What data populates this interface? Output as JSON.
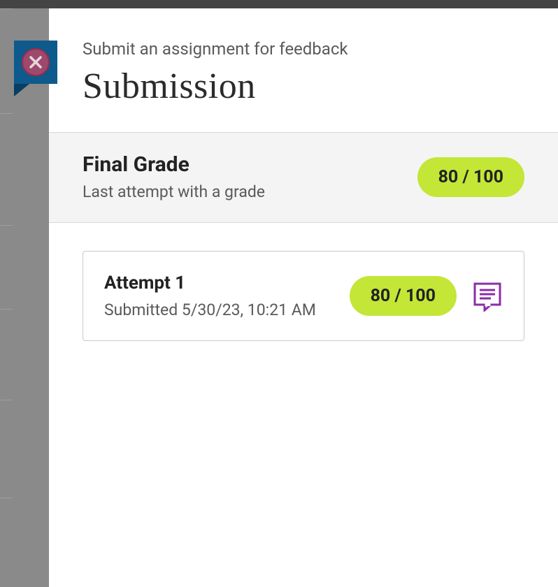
{
  "header": {
    "pretitle": "Submit an assignment for feedback",
    "title": "Submission"
  },
  "finalGrade": {
    "label": "Final Grade",
    "sub": "Last attempt with a grade",
    "score": "80 / 100"
  },
  "attempts": [
    {
      "title": "Attempt 1",
      "sub": "Submitted 5/30/23, 10:21 AM",
      "score": "80 / 100"
    }
  ],
  "colors": {
    "pill": "#c3e637",
    "badge": "#0e5a8c",
    "feedback": "#8a2ea8"
  }
}
